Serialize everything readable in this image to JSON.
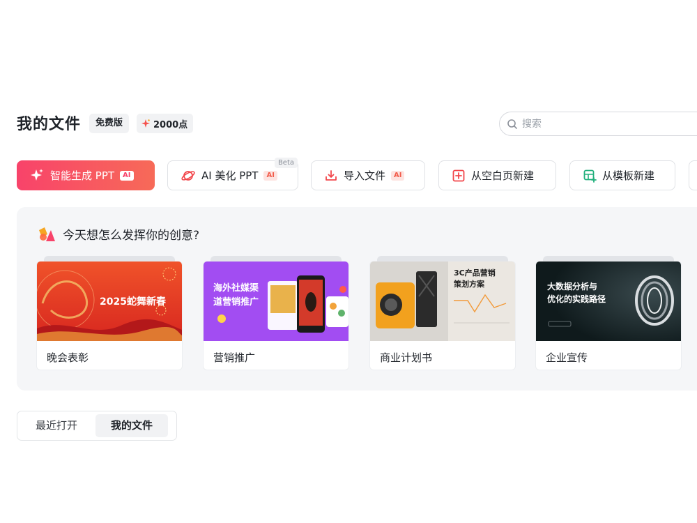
{
  "header": {
    "title": "我的文件",
    "plan_badge": "免费版",
    "points_badge": "2000点"
  },
  "search": {
    "placeholder": "搜索"
  },
  "actions": [
    {
      "label": "智能生成 PPT",
      "ai": "AI",
      "icon": "sparkle-icon"
    },
    {
      "label": "AI 美化 PPT",
      "ai": "AI",
      "beta": "Beta",
      "icon": "planet-icon"
    },
    {
      "label": "导入文件",
      "ai": "AI",
      "icon": "import-icon"
    },
    {
      "label": "从空白页新建",
      "icon": "plus-square-icon"
    },
    {
      "label": "从模板新建",
      "icon": "template-icon"
    }
  ],
  "inspiration": {
    "heading": "今天想怎么发挥你的创意?",
    "cards": [
      {
        "label": "晚会表彰",
        "thumb_title": "2025蛇舞新春"
      },
      {
        "label": "营销推广",
        "thumb_title_line1": "海外社媒渠",
        "thumb_title_line2": "道营销推广"
      },
      {
        "label": "商业计划书",
        "thumb_title_line1": "3C产品营销",
        "thumb_title_line2": "策划方案"
      },
      {
        "label": "企业宣传",
        "thumb_title_line1": "大数据分析与",
        "thumb_title_line2": "优化的实践路径"
      }
    ]
  },
  "tabs": [
    {
      "label": "最近打开",
      "active": false
    },
    {
      "label": "我的文件",
      "active": true
    }
  ],
  "colors": {
    "primary_gradient_start": "#f8436a",
    "primary_gradient_end": "#f76a58",
    "ai_tag": "#f25b4a"
  }
}
